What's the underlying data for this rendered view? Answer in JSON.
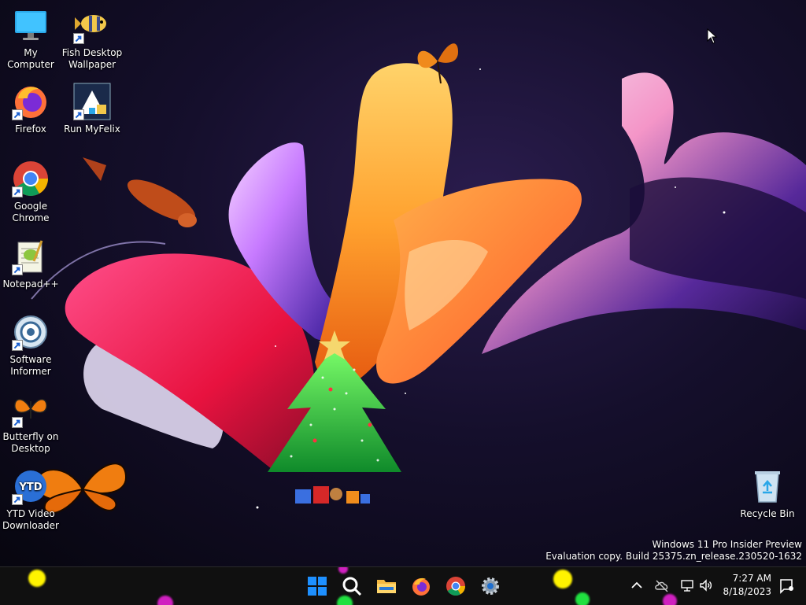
{
  "desktop": {
    "icons": [
      {
        "label": "My Computer",
        "icon": "computer-icon"
      },
      {
        "label": "Fish Desktop\nWallpaper",
        "icon": "fish-icon"
      },
      {
        "label": "Firefox",
        "icon": "firefox-icon"
      },
      {
        "label": "Run MyFelix",
        "icon": "myfelix-icon"
      },
      {
        "label": "Google\nChrome",
        "icon": "chrome-icon"
      },
      {
        "label": "Notepad++",
        "icon": "notepadpp-icon"
      },
      {
        "label": "Software\nInformer",
        "icon": "software-informer-icon"
      },
      {
        "label": "Butterfly on\nDesktop",
        "icon": "butterfly-icon"
      },
      {
        "label": "YTD Video\nDownloader",
        "icon": "ytd-icon"
      },
      {
        "label": "Recycle Bin",
        "icon": "recycle-bin-icon"
      }
    ],
    "ytd_badge": "YTD"
  },
  "watermark": {
    "line1": "Windows 11 Pro Insider Preview",
    "line2": "Evaluation copy. Build 25375.zn_release.230520-1632"
  },
  "taskbar": {
    "apps": [
      "start-icon",
      "search-icon",
      "file-explorer-icon",
      "firefox-icon",
      "chrome-icon",
      "settings-icon"
    ],
    "tray": [
      "chevron-up-icon",
      "onedrive-icon",
      "network-icon",
      "volume-icon"
    ],
    "time": "7:27 AM",
    "date": "8/18/2023"
  },
  "colors": {
    "taskbar_bg": "#101010",
    "windows_blue": "#1e90ff",
    "firefox_orange": "#ff7139",
    "chrome_red": "#db4437",
    "chrome_green": "#0f9d58",
    "chrome_yellow": "#f4b400",
    "chrome_blue": "#4285f4"
  }
}
